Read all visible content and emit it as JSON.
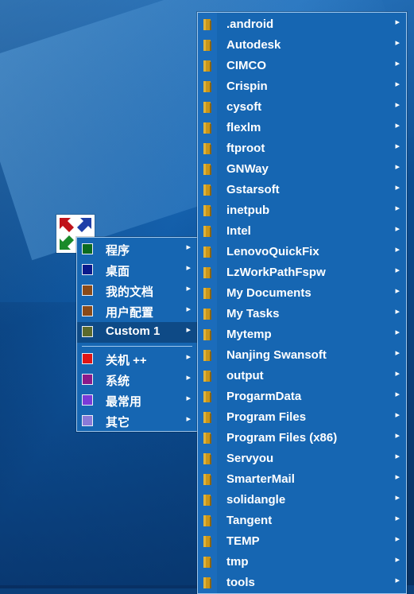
{
  "main_menu": {
    "items": [
      {
        "label": "程序",
        "color": "#0b6b1f"
      },
      {
        "label": "桌面",
        "color": "#0a1a8c"
      },
      {
        "label": "我的文档",
        "color": "#8a4a18"
      },
      {
        "label": "用户配置",
        "color": "#8a4a18"
      },
      {
        "label": "Custom 1",
        "color": "#5c6a2c",
        "selected": true
      },
      {
        "label": "关机 ++",
        "color": "#e01515"
      },
      {
        "label": "系统",
        "color": "#8a1a8a"
      },
      {
        "label": "最常用",
        "color": "#7a3ad8"
      },
      {
        "label": "其它",
        "color": "#8a7ad8"
      }
    ]
  },
  "submenu": {
    "items": [
      ".android",
      "Autodesk",
      "CIMCO",
      "Crispin",
      "cysoft",
      "flexlm",
      "ftproot",
      "GNWay",
      "Gstarsoft",
      "inetpub",
      "Intel",
      "LenovoQuickFix",
      "LzWorkPathFspw",
      "My Documents",
      "My Tasks",
      "Mytemp",
      "Nanjing Swansoft",
      "output",
      "ProgarmData",
      "Program Files",
      "Program Files (x86)",
      "Servyou",
      "SmarterMail",
      "solidangle",
      "Tangent",
      "TEMP",
      "tmp",
      "tools"
    ]
  },
  "icons": {
    "arrow": "chevron-right-icon",
    "folder": "folder-icon",
    "app": "app-arrows-icon"
  },
  "colors": {
    "menu_bg": "#1666b2",
    "menu_border": "#9ec6ec",
    "selected_bg": "#0e4a86",
    "folder": "#c9961a"
  }
}
